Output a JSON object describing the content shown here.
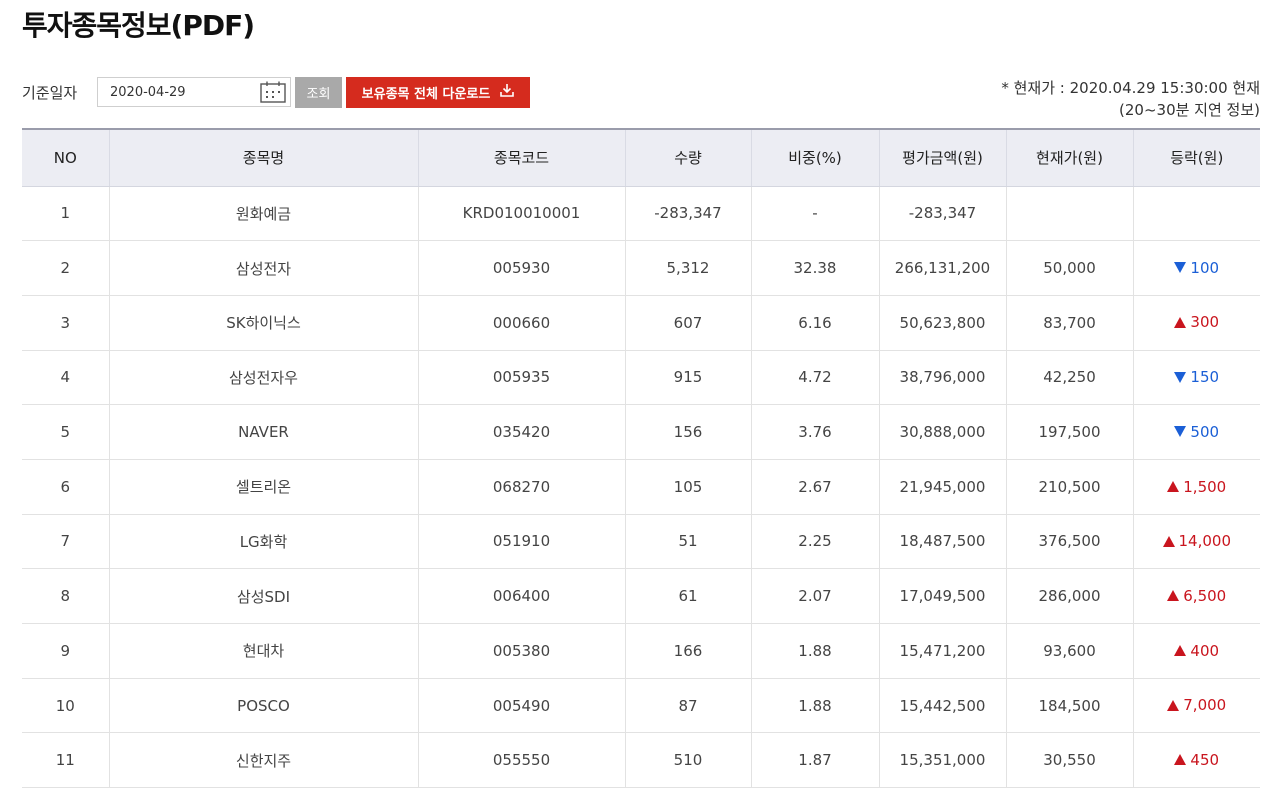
{
  "page": {
    "title": "투자종목정보(PDF)"
  },
  "filter": {
    "date_label": "기준일자",
    "date_value": "2020-04-29",
    "query_label": "조회",
    "download_label": "보유종목 전체 다운로드"
  },
  "notice": {
    "line1": "* 현재가 : 2020.04.29 15:30:00 현재",
    "line2": "(20~30분 지연 정보)"
  },
  "colors": {
    "up": "#c9151e",
    "down": "#1b5fd6",
    "download_button": "#d52b1e",
    "header_bg": "#ecedf3"
  },
  "table": {
    "columns": [
      "NO",
      "종목명",
      "종목코드",
      "수량",
      "비중(%)",
      "평가금액(원)",
      "현재가(원)",
      "등락(원)"
    ],
    "rows": [
      {
        "no": "1",
        "name": "원화예금",
        "code": "KRD010010001",
        "qty": "-283,347",
        "weight": "-",
        "value": "-283,347",
        "price": "",
        "change": "",
        "dir": ""
      },
      {
        "no": "2",
        "name": "삼성전자",
        "code": "005930",
        "qty": "5,312",
        "weight": "32.38",
        "value": "266,131,200",
        "price": "50,000",
        "change": "100",
        "dir": "down"
      },
      {
        "no": "3",
        "name": "SK하이닉스",
        "code": "000660",
        "qty": "607",
        "weight": "6.16",
        "value": "50,623,800",
        "price": "83,700",
        "change": "300",
        "dir": "up"
      },
      {
        "no": "4",
        "name": "삼성전자우",
        "code": "005935",
        "qty": "915",
        "weight": "4.72",
        "value": "38,796,000",
        "price": "42,250",
        "change": "150",
        "dir": "down"
      },
      {
        "no": "5",
        "name": "NAVER",
        "code": "035420",
        "qty": "156",
        "weight": "3.76",
        "value": "30,888,000",
        "price": "197,500",
        "change": "500",
        "dir": "down"
      },
      {
        "no": "6",
        "name": "셀트리온",
        "code": "068270",
        "qty": "105",
        "weight": "2.67",
        "value": "21,945,000",
        "price": "210,500",
        "change": "1,500",
        "dir": "up"
      },
      {
        "no": "7",
        "name": "LG화학",
        "code": "051910",
        "qty": "51",
        "weight": "2.25",
        "value": "18,487,500",
        "price": "376,500",
        "change": "14,000",
        "dir": "up"
      },
      {
        "no": "8",
        "name": "삼성SDI",
        "code": "006400",
        "qty": "61",
        "weight": "2.07",
        "value": "17,049,500",
        "price": "286,000",
        "change": "6,500",
        "dir": "up"
      },
      {
        "no": "9",
        "name": "현대차",
        "code": "005380",
        "qty": "166",
        "weight": "1.88",
        "value": "15,471,200",
        "price": "93,600",
        "change": "400",
        "dir": "up"
      },
      {
        "no": "10",
        "name": "POSCO",
        "code": "005490",
        "qty": "87",
        "weight": "1.88",
        "value": "15,442,500",
        "price": "184,500",
        "change": "7,000",
        "dir": "up"
      },
      {
        "no": "11",
        "name": "신한지주",
        "code": "055550",
        "qty": "510",
        "weight": "1.87",
        "value": "15,351,000",
        "price": "30,550",
        "change": "450",
        "dir": "up"
      }
    ]
  }
}
